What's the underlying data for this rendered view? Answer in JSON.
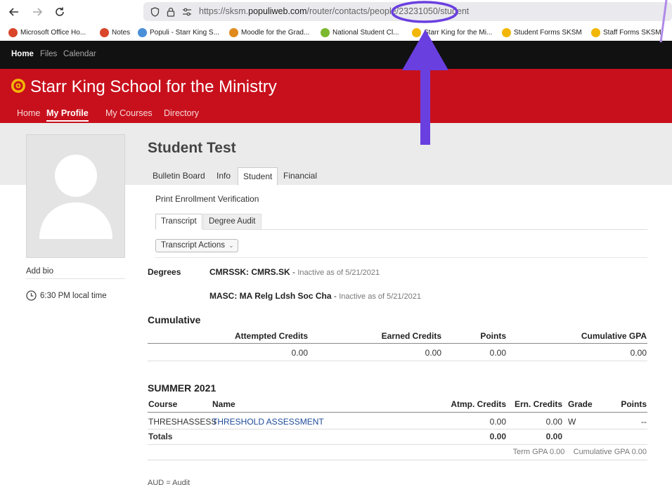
{
  "browser": {
    "url_prefix": "https://sksm.",
    "url_domain": "populiweb.com",
    "url_path": "/router/contacts/people/23231050/student",
    "bookmarks": [
      {
        "label": "Microsoft Office Ho...",
        "color": "#d9462a"
      },
      {
        "label": "Notes",
        "color": "#d9462a"
      },
      {
        "label": "Populi - Starr King S...",
        "color": "#4a90d9"
      },
      {
        "label": "Moodle for the Grad...",
        "color": "#e08a1e"
      },
      {
        "label": "National Student Cl...",
        "color": "#7cb82f"
      },
      {
        "label": "Starr King for the Mi...",
        "color": "#f2b705"
      },
      {
        "label": "Student Forms SKSM",
        "color": "#f2b705"
      },
      {
        "label": "Staff Forms SKSM",
        "color": "#f2b705"
      }
    ]
  },
  "topnav": {
    "home": "Home",
    "files": "Files",
    "calendar": "Calendar"
  },
  "header": {
    "school_name": "Starr King School for the Ministry",
    "nav": [
      "Home",
      "My Profile",
      "My Courses",
      "Directory"
    ],
    "brand_color": "#c8101c"
  },
  "profile": {
    "name": "Student Test",
    "tabs": [
      "Bulletin Board",
      "Info",
      "Student",
      "Financial"
    ],
    "add_bio": "Add bio",
    "local_time": "6:30 PM local time"
  },
  "student": {
    "print_link": "Print Enrollment Verification",
    "subtabs": [
      "Transcript",
      "Degree Audit"
    ],
    "actions_label": "Transcript Actions",
    "degrees_label": "Degrees",
    "degrees": [
      {
        "code": "CMRSSK: CMRS.SK",
        "status": "Inactive as of 5/21/2021"
      },
      {
        "code": "MASC: MA Relg Ldsh Soc Cha",
        "status": "Inactive as of 5/21/2021"
      }
    ],
    "cumulative": {
      "title": "Cumulative",
      "headers": [
        "Attempted Credits",
        "Earned Credits",
        "Points",
        "Cumulative GPA"
      ],
      "values": [
        "0.00",
        "0.00",
        "0.00",
        "0.00"
      ]
    },
    "term": {
      "title": "SUMMER 2021",
      "headers": [
        "Course",
        "Name",
        "Atmp. Credits",
        "Ern. Credits",
        "Grade",
        "Points"
      ],
      "row": {
        "course": "THRESHASSESS",
        "name": "THRESHOLD ASSESSMENT",
        "atmp": "0.00",
        "ern": "0.00",
        "grade": "W",
        "points": "--"
      },
      "totals": {
        "label": "Totals",
        "atmp": "0.00",
        "ern": "0.00"
      },
      "term_gpa_label": "Term GPA",
      "term_gpa": "0.00",
      "cum_gpa_label": "Cumulative GPA",
      "cum_gpa": "0.00"
    },
    "footnote": "AUD = Audit"
  },
  "annotation": {
    "color": "#6a3fe0"
  }
}
